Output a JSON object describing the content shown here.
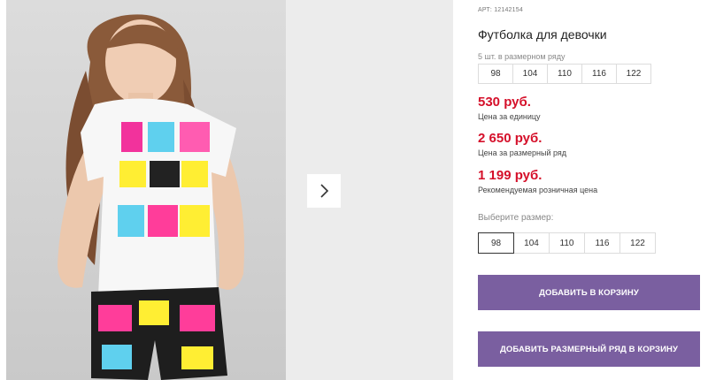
{
  "product": {
    "article": "АРТ: 12142154",
    "title": "Футболка для девочки",
    "pack_caption": "5 шт. в размерном ряду",
    "pack_sizes": [
      "98",
      "104",
      "110",
      "116",
      "122"
    ],
    "prices": [
      {
        "value": "530 руб.",
        "label": "Цена за единицу"
      },
      {
        "value": "2 650 руб.",
        "label": "Цена за размерный ряд"
      },
      {
        "value": "1 199 руб.",
        "label": "Рекомендуемая розничная цена"
      }
    ],
    "choose_label": "Выберите размер:",
    "sizes": [
      "98",
      "104",
      "110",
      "116",
      "122"
    ],
    "selected_size": "98"
  },
  "buttons": {
    "add_to_cart": "Добавить в корзину",
    "add_pack_to_cart": "Добавить размерный ряд в корзину"
  },
  "colors": {
    "price": "#d5102a",
    "button": "#7a5fa0"
  },
  "icons": {
    "next": "chevron-right-icon"
  }
}
